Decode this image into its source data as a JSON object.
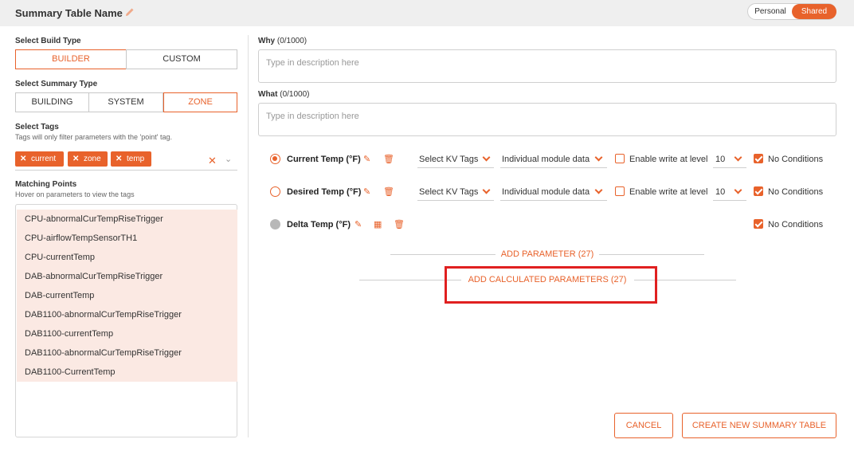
{
  "header": {
    "title": "Summary Table Name",
    "toggle": {
      "personal": "Personal",
      "shared": "Shared",
      "selected": "Shared"
    }
  },
  "build_type": {
    "label": "Select Build Type",
    "options": [
      "BUILDER",
      "CUSTOM"
    ],
    "selected": "BUILDER"
  },
  "summary_type": {
    "label": "Select Summary Type",
    "options": [
      "BUILDING",
      "SYSTEM",
      "ZONE"
    ],
    "selected": "ZONE"
  },
  "tags": {
    "label": "Select Tags",
    "hint": "Tags will only filter parameters with the 'point' tag.",
    "chips": [
      "current",
      "zone",
      "temp"
    ]
  },
  "matching": {
    "label": "Matching Points",
    "hint": "Hover on parameters to view the tags",
    "items": [
      "CPU-abnormalCurTempRiseTrigger",
      "CPU-airflowTempSensorTH1",
      "CPU-currentTemp",
      "DAB-abnormalCurTempRiseTrigger",
      "DAB-currentTemp",
      "DAB1100-abnormalCurTempRiseTrigger",
      "DAB1100-currentTemp",
      "DAB1100-abnormalCurTempRiseTrigger",
      "DAB1100-CurrentTemp"
    ]
  },
  "why": {
    "label": "Why",
    "count": "(0/1000)",
    "placeholder": "Type in description here"
  },
  "what": {
    "label": "What",
    "count": "(0/1000)",
    "placeholder": "Type in description here"
  },
  "params": [
    {
      "name": "Current Temp (°F)",
      "kv": "Select KV Tags",
      "module": "Individual module data",
      "write_label": "Enable write at level",
      "level": "10",
      "cond": "No Conditions",
      "selected": true
    },
    {
      "name": "Desired Temp (°F)",
      "kv": "Select KV Tags",
      "module": "Individual module data",
      "write_label": "Enable write at level",
      "level": "10",
      "cond": "No Conditions",
      "selected": false
    },
    {
      "name": "Delta Temp (°F)",
      "cond": "No Conditions"
    }
  ],
  "add_param": "ADD PARAMETER (27)",
  "add_calc": "ADD CALCULATED PARAMETERS (27)",
  "buttons": {
    "cancel": "CANCEL",
    "create": "CREATE NEW SUMMARY TABLE"
  },
  "colors": {
    "accent": "#e8622b",
    "highlight": "#e02020",
    "item_bg": "#fbe9e3"
  }
}
